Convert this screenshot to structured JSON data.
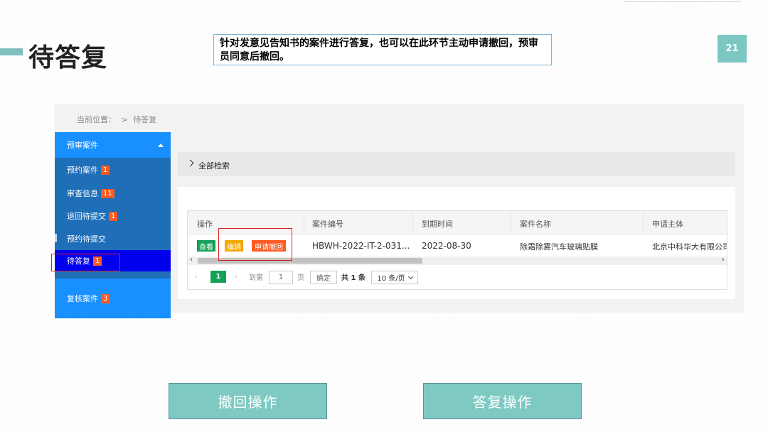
{
  "slide": {
    "title": "待答复",
    "note": "针对发意见告知书的案件进行答复，也可以在此环节主动申请撤回，预审员同意后撤回。",
    "page_number": "21",
    "accent_color": "#7cc7c2"
  },
  "breadcrumb": {
    "label": "当前位置：",
    "separator": ">",
    "current": "待答复"
  },
  "sidebar": {
    "header": "预审案件",
    "items": [
      {
        "label": "预约案件",
        "badge": "1"
      },
      {
        "label": "审查信息",
        "badge": "11"
      },
      {
        "label": "退回待提交",
        "badge": "1"
      },
      {
        "label": "预约待提交",
        "badge": ""
      },
      {
        "label": "待答复",
        "badge": "1"
      },
      {
        "label": "复核案件",
        "badge": "3"
      }
    ]
  },
  "search": {
    "label": "全部检索"
  },
  "table": {
    "headers": [
      "操作",
      "案件编号",
      "到期时间",
      "案件名称",
      "申请主体"
    ],
    "actions": [
      "查看",
      "编辑",
      "申请撤回"
    ],
    "rows": [
      {
        "case_no": "HBWH-2022-IT-2-031...",
        "due": "2022-08-30",
        "name": "除霜除雾汽车玻璃贴膜",
        "applicant": "北京中科华大有限公司"
      }
    ]
  },
  "pagination": {
    "current_page": "1",
    "goto_label": "到第",
    "goto_value": "1",
    "page_label": "页",
    "confirm": "确定",
    "total": "共 1 条",
    "page_size": "10 条/页"
  },
  "buttons": {
    "withdraw": "撤回操作",
    "reply": "答复操作"
  }
}
